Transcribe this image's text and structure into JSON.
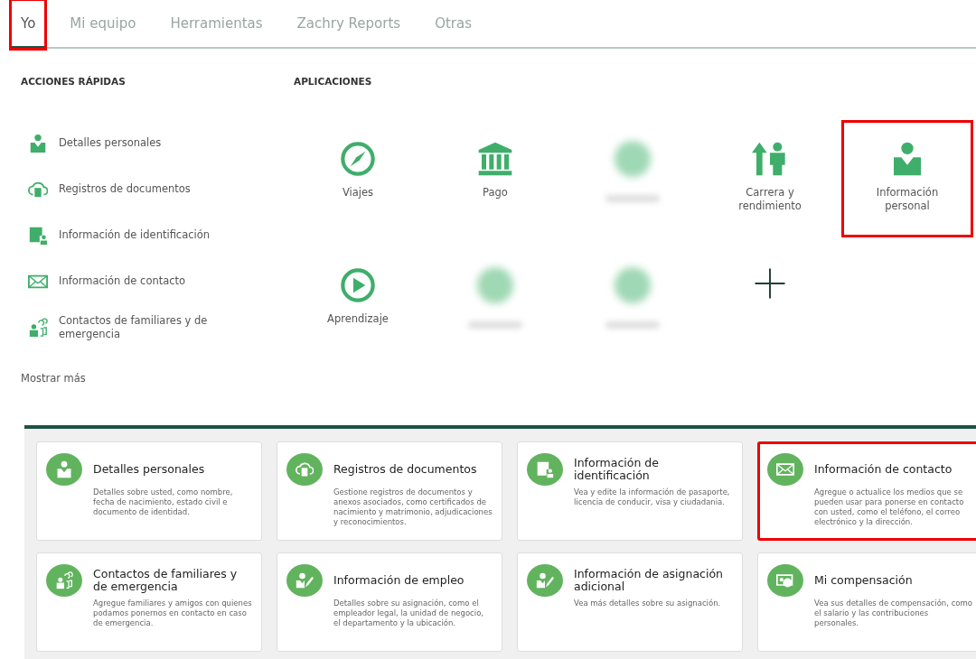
{
  "tabs": [
    {
      "label": "Yo",
      "selected": true,
      "highlighted": true
    },
    {
      "label": "Mi equipo",
      "selected": false,
      "highlighted": false
    },
    {
      "label": "Herramientas",
      "selected": false,
      "highlighted": false
    },
    {
      "label": "Zachry Reports",
      "selected": false,
      "highlighted": false
    },
    {
      "label": "Otras",
      "selected": false,
      "highlighted": false
    }
  ],
  "quick_actions": {
    "title": "ACCIONES RÁPIDAS",
    "items": [
      {
        "label": "Detalles personales",
        "kind": "person"
      },
      {
        "label": "Registros de documentos",
        "kind": "cloud"
      },
      {
        "label": "Información de identificación",
        "kind": "idcard"
      },
      {
        "label": "Información de contacto",
        "kind": "mail"
      },
      {
        "label": "Contactos de familiares y de emergencia",
        "kind": "family"
      }
    ],
    "more_link": "Mostrar más"
  },
  "applications": {
    "title": "APLICACIONES",
    "items": [
      {
        "kind": "compass",
        "label": "Viajes",
        "highlighted": false
      },
      {
        "kind": "bank",
        "label": "Pago",
        "highlighted": false
      },
      {
        "kind": "blurred",
        "highlighted": false
      },
      {
        "kind": "career",
        "label": "Carrera y rendimiento",
        "highlighted": false
      },
      {
        "kind": "person",
        "label": "Información personal",
        "highlighted": true
      },
      {
        "kind": "play",
        "label": "Aprendizaje",
        "highlighted": false
      },
      {
        "kind": "blurred",
        "highlighted": false
      },
      {
        "kind": "blurred",
        "highlighted": false
      },
      {
        "kind": "add",
        "highlighted": false
      }
    ]
  },
  "cards": [
    {
      "kind": "person",
      "title": "Detalles personales",
      "description": "Detalles sobre usted, como nombre, fecha de nacimiento, estado civil e documento de identidad.",
      "highlighted": false
    },
    {
      "kind": "cloud",
      "title": "Registros de documentos",
      "description": "Gestione registros de documentos y anexos asociados, como certificados de nacimiento y matrimonio, adjudicaciones y reconocimientos.",
      "highlighted": false
    },
    {
      "kind": "idcard",
      "title": "Información de identificación",
      "description": "Vea y edite la información de pasaporte, licencia de conducir, visa y ciudadania.",
      "highlighted": false
    },
    {
      "kind": "mail",
      "title": "Información de contacto",
      "description": "Agregue o actualice los medios que se pueden usar para ponerse en contacto con usted, como el teléfono, el correo electrónico y la dirección.",
      "highlighted": true
    },
    {
      "kind": "family",
      "title": "Contactos de familiares y de emergencia",
      "description": "Agregue familiares y amigos con quienes podamos ponernos en contacto en caso de emergencia.",
      "highlighted": false
    },
    {
      "kind": "edit",
      "title": "Información de empleo",
      "description": "Detalles sobre su asignación, como el empleador legal, la unidad de negocio, el departamento y la ubicación.",
      "highlighted": false
    },
    {
      "kind": "edit",
      "title": "Información de asignación adicional",
      "description": "Vea más detalles sobre su asignación.",
      "highlighted": false
    },
    {
      "kind": "money",
      "title": "Mi compensación",
      "description": "Vea sus detalles de compensación, como el salario y las contribuciones personales.",
      "highlighted": false
    }
  ]
}
